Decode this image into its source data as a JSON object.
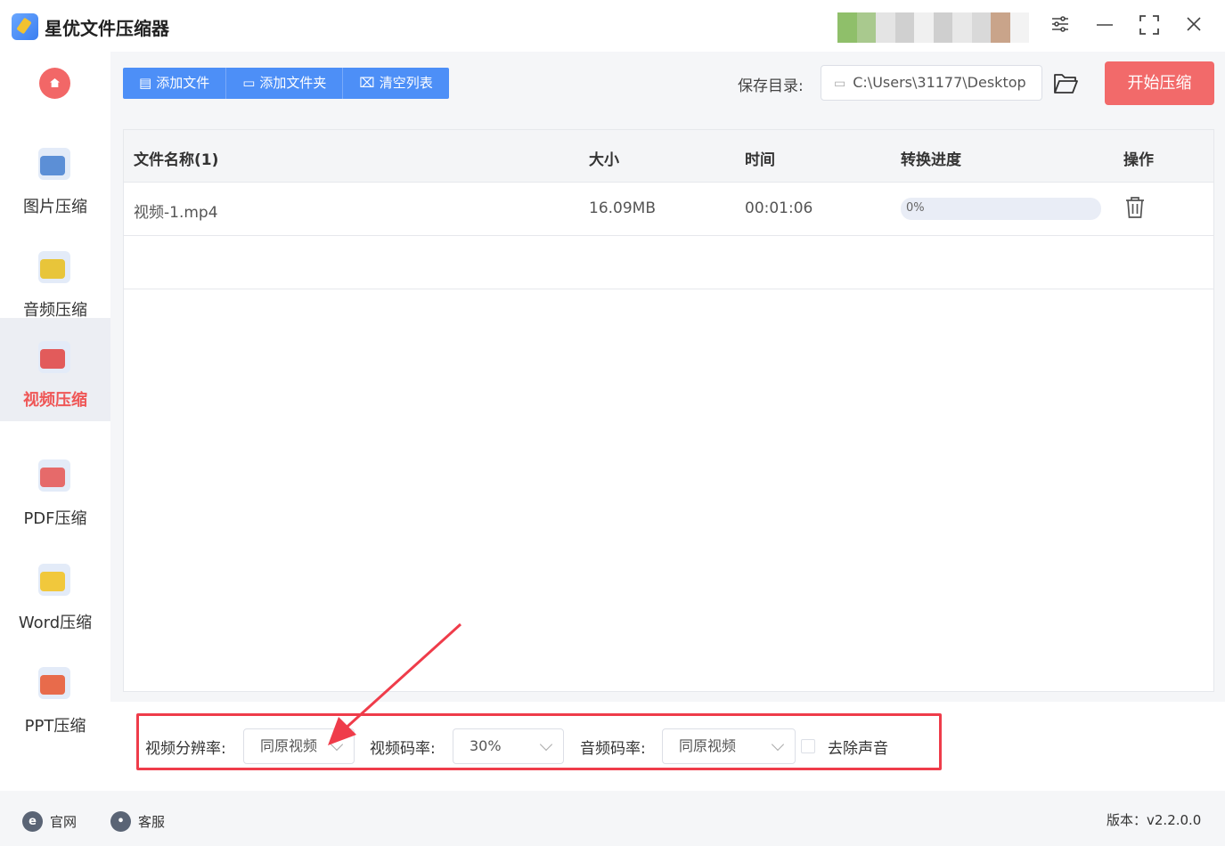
{
  "app": {
    "title": "星优文件压缩器"
  },
  "window_controls": [
    "settings-sliders",
    "minimize",
    "maximize",
    "close"
  ],
  "sidebar": {
    "items": [
      {
        "label": "图片压缩",
        "icon": "image-icon",
        "active": false
      },
      {
        "label": "音频压缩",
        "icon": "music-icon",
        "active": false
      },
      {
        "label": "视频压缩",
        "icon": "video-icon",
        "active": true
      },
      {
        "label": "PDF压缩",
        "icon": "pdf-icon",
        "active": false
      },
      {
        "label": "Word压缩",
        "icon": "word-icon",
        "active": false
      },
      {
        "label": "PPT压缩",
        "icon": "ppt-icon",
        "active": false
      }
    ]
  },
  "toolbar": {
    "add_file": "添加文件",
    "add_folder": "添加文件夹",
    "clear_list": "清空列表",
    "save_label": "保存目录:",
    "save_path": "C:\\Users\\31177\\Desktop",
    "start": "开始压缩"
  },
  "table": {
    "headers": [
      "文件名称(1)",
      "大小",
      "时间",
      "转换进度",
      "操作"
    ],
    "rows": [
      {
        "name": "视频-1.mp4",
        "size": "16.09MB",
        "time": "00:01:06",
        "progress": "0%",
        "progress_value": 0
      }
    ]
  },
  "settings": {
    "resolution_label": "视频分辨率:",
    "resolution_value": "同原视频",
    "bitrate_label": "视频码率:",
    "bitrate_value": "30%",
    "audio_label": "音频码率:",
    "audio_value": "同原视频",
    "mute_label": "去除声音",
    "mute_checked": false
  },
  "footer": {
    "website": "官网",
    "support": "客服",
    "version": "版本：v2.2.0.0"
  },
  "colors": {
    "primary": "#4d8ff7",
    "accent_red": "#f26a6a",
    "highlight": "#ef3c4a"
  }
}
